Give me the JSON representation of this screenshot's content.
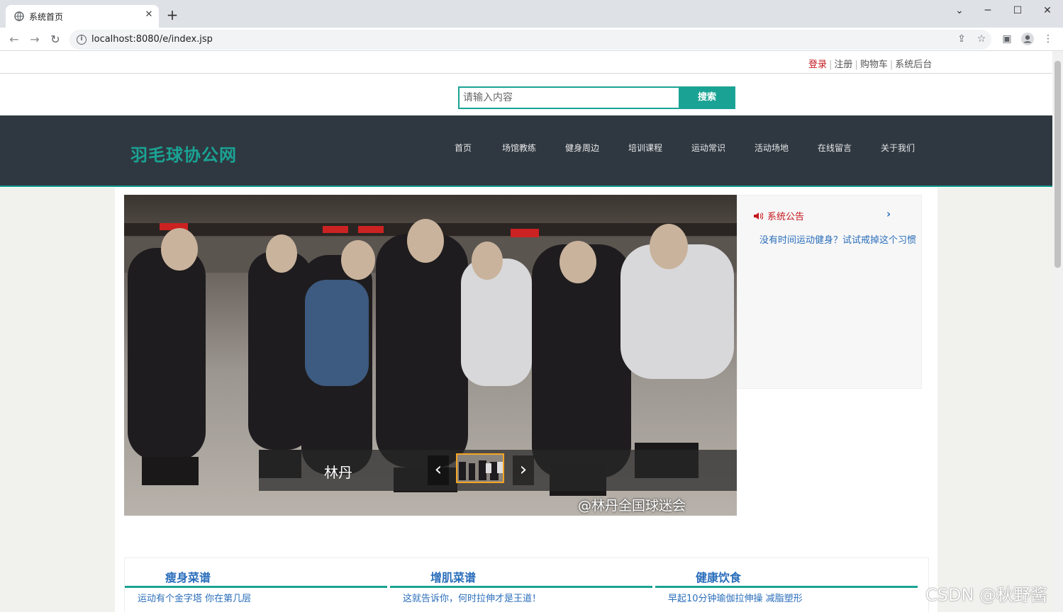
{
  "browser": {
    "tab_title": "系统首页",
    "tab_close": "✕",
    "new_tab": "+",
    "url": "localhost:8080/e/index.jsp",
    "win_min": "─",
    "win_max": "☐",
    "win_close": "✕",
    "win_dropdown": "⌄"
  },
  "header": {
    "login": "登录",
    "register": "注册",
    "cart": "购物车",
    "admin": "系统后台"
  },
  "search": {
    "placeholder": "请输入内容",
    "button": "搜索"
  },
  "nav": {
    "logo": "羽毛球协公网",
    "items": [
      "首页",
      "场馆教练",
      "健身周边",
      "培训课程",
      "运动常识",
      "活动场地",
      "在线留言",
      "关于我们"
    ]
  },
  "carousel": {
    "caption": "林丹",
    "prev": "‹",
    "next": "›",
    "watermark": "@林丹全国球迷会"
  },
  "notice": {
    "title": "系统公告",
    "chevron": "›",
    "link": "没有时间运动健身？试试戒掉这个习惯"
  },
  "columns": [
    {
      "title": "瘦身菜谱",
      "item": "运动有个金字塔 你在第几层"
    },
    {
      "title": "增肌菜谱",
      "item": "这就告诉你，何时拉伸才是王道！"
    },
    {
      "title": "健康饮食",
      "item": "早起10分钟瑜伽拉伸操 减脂塑形"
    }
  ],
  "overlay": {
    "watermark": "CSDN @秋野酱"
  },
  "colors": {
    "accent": "#1aa394",
    "nav_bg": "#2f3841",
    "link": "#2a6ebb",
    "alert": "#c4161c"
  }
}
